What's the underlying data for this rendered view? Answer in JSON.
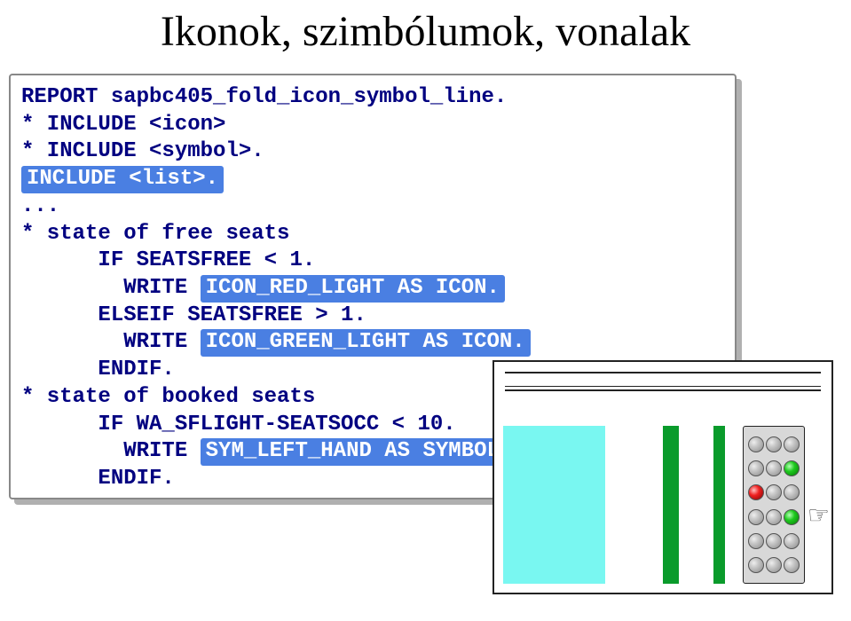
{
  "title": "Ikonok, szimbólumok, vonalak",
  "code": {
    "l1": "REPORT sapbc405_fold_icon_symbol_line.",
    "l2": "* INCLUDE <icon>",
    "l3": "* INCLUDE <symbol>.",
    "l4": "INCLUDE <list>.",
    "l5": "...",
    "l6": "* state of free seats",
    "l7": "      IF SEATSFREE < 1.",
    "l8a": "        WRITE ",
    "l8b": "ICON_RED_LIGHT AS ICON.",
    "l9": "      ELSEIF SEATSFREE > 1.",
    "l10a": "        WRITE ",
    "l10b": "ICON_GREEN_LIGHT AS ICON.",
    "l11": "      ENDIF.",
    "l12": "* state of booked seats",
    "l13": "      IF WA_SFLIGHT-SEATSOCC < 10.",
    "l14a": "        WRITE ",
    "l14b": "SYM_LEFT_HAND AS SYMBOL.",
    "l15": "      ENDIF."
  },
  "lights": {
    "rows": [
      [
        "off",
        "off",
        "off"
      ],
      [
        "off",
        "off",
        "green"
      ],
      [
        "red",
        "off",
        "off"
      ],
      [
        "off",
        "off",
        "green"
      ],
      [
        "off",
        "off",
        "off"
      ],
      [
        "off",
        "off",
        "off"
      ]
    ]
  },
  "cursor_glyph": "☞"
}
